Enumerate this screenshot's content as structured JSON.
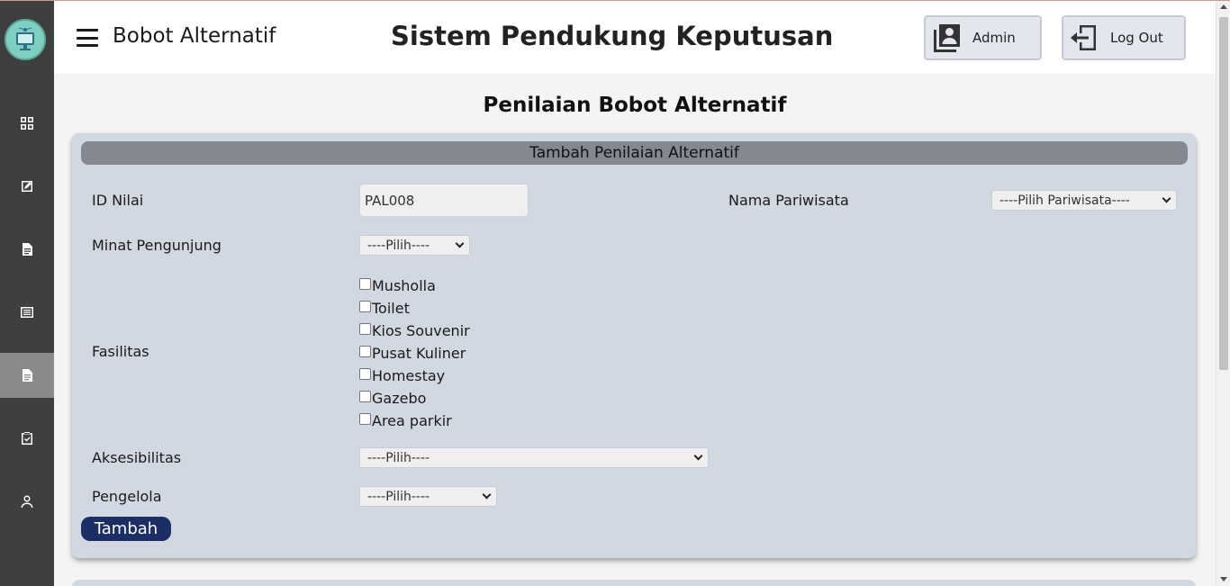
{
  "header": {
    "page_name": "Bobot Alternatif",
    "app_title": "Sistem Pendukung Keputusan",
    "admin_label": "Admin",
    "logout_label": "Log Out"
  },
  "sidebar": {
    "items": [
      {
        "icon": "dashboard-icon",
        "active": false
      },
      {
        "icon": "edit-icon",
        "active": false
      },
      {
        "icon": "document-icon",
        "active": false
      },
      {
        "icon": "list-icon",
        "active": false
      },
      {
        "icon": "document-icon",
        "active": true
      },
      {
        "icon": "clipboard-check-icon",
        "active": false
      },
      {
        "icon": "user-icon",
        "active": false
      }
    ]
  },
  "main": {
    "section_title": "Penilaian Bobot Alternatif",
    "form": {
      "card_title": "Tambah Penilaian Alternatif",
      "id_label": "ID Nilai",
      "id_value": "PAL008",
      "pariwisata_label": "Nama Pariwisata",
      "pariwisata_selected": "----Pilih Pariwisata----",
      "minat_label": "Minat Pengunjung",
      "minat_selected": "----Pilih----",
      "fasilitas_label": "Fasilitas",
      "fasilitas_options": [
        "Musholla",
        "Toilet",
        "Kios Souvenir",
        "Pusat Kuliner",
        "Homestay",
        "Gazebo",
        "Area parkir"
      ],
      "aksesibilitas_label": "Aksesibilitas",
      "aksesibilitas_selected": "----Pilih----",
      "pengelola_label": "Pengelola",
      "pengelola_selected": "----Pilih----",
      "submit_label": "Tambah"
    }
  },
  "colors": {
    "sidebar_bg": "#3f3f3f",
    "sidebar_active": "#8a8a8a",
    "card_bg": "#d2d8e1",
    "card_header": "#858890",
    "submit_button": "#1b2e66"
  }
}
